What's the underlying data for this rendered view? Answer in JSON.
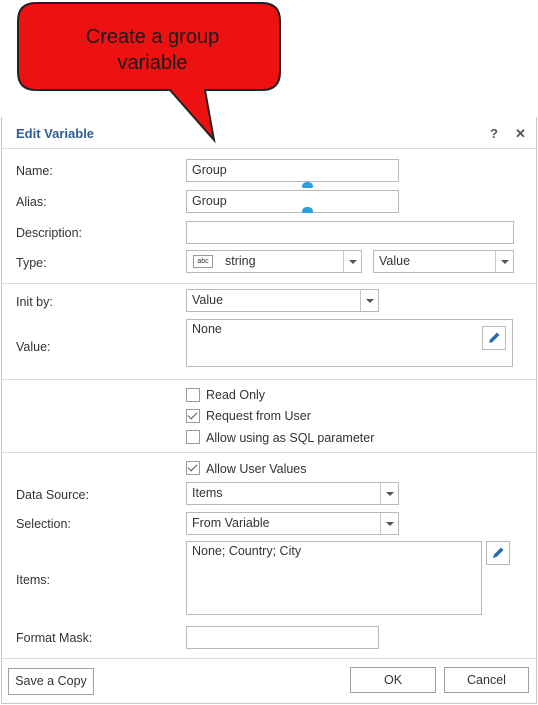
{
  "callout": {
    "text_line1": "Create a group",
    "text_line2": "variable"
  },
  "dialog": {
    "title": "Edit Variable",
    "help_glyph": "?",
    "close_glyph": "✕",
    "name": {
      "label": "Name:",
      "value": "Group"
    },
    "alias": {
      "label": "Alias:",
      "value": "Group"
    },
    "description": {
      "label": "Description:",
      "value": ""
    },
    "type": {
      "label": "Type:",
      "type_icon": "abc",
      "type_value": "string",
      "kind_value": "Value"
    },
    "init_by": {
      "label": "Init by:",
      "value": "Value"
    },
    "value": {
      "label": "Value:",
      "text": "None"
    },
    "read_only": {
      "label": "Read Only",
      "checked": false
    },
    "request_from_user": {
      "label": "Request from User",
      "checked": true
    },
    "allow_sql": {
      "label": "Allow using as SQL parameter",
      "checked": false
    },
    "allow_user_values": {
      "label": "Allow User Values",
      "checked": true
    },
    "data_source": {
      "label": "Data Source:",
      "value": "Items"
    },
    "selection": {
      "label": "Selection:",
      "value": "From Variable"
    },
    "items": {
      "label": "Items:",
      "text": "None; Country; City"
    },
    "format_mask": {
      "label": "Format Mask:",
      "value": ""
    },
    "buttons": {
      "save_copy": "Save a Copy",
      "ok": "OK",
      "cancel": "Cancel"
    }
  },
  "colors": {
    "callout_fill": "#ee1111",
    "title": "#2e5d96",
    "accent": "#29a0e0"
  }
}
